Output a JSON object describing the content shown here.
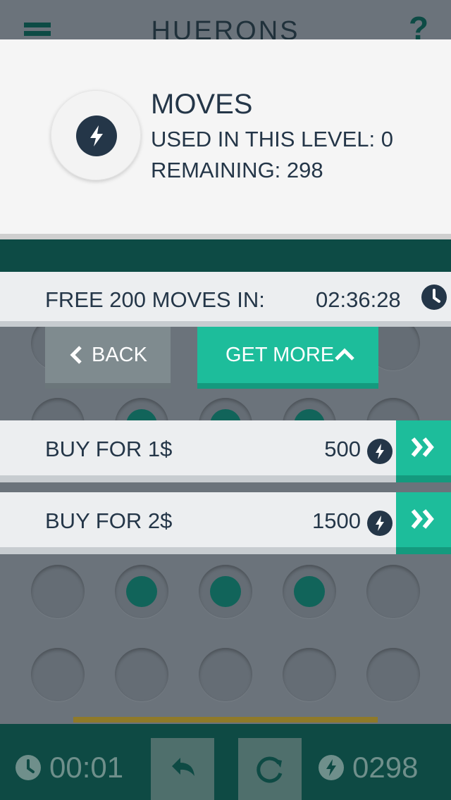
{
  "app": {
    "title": "HUERONS"
  },
  "panel": {
    "title": "MOVES",
    "used_label": "USED IN THIS LEVEL: 0",
    "remaining_label": "REMAINING: 298"
  },
  "free": {
    "label": "FREE 200 MOVES IN:",
    "time": "02:36:28"
  },
  "buttons": {
    "back": "BACK",
    "get_more": "GET MORE"
  },
  "offers": [
    {
      "label": "BUY FOR 1$",
      "amount": "500"
    },
    {
      "label": "BUY FOR 2$",
      "amount": "1500"
    }
  ],
  "bottom": {
    "timer": "00:01",
    "moves": "0298"
  },
  "colors": {
    "accent": "#1dbd9b",
    "dark_teal": "#0d4b45",
    "navy": "#243648",
    "background": "#6b737b"
  },
  "icons": [
    "menu-icon",
    "help-icon",
    "lightning-icon",
    "clock-icon",
    "chevron-left-icon",
    "chevron-up-icon",
    "double-chevron-right-icon",
    "undo-icon",
    "reset-icon"
  ]
}
